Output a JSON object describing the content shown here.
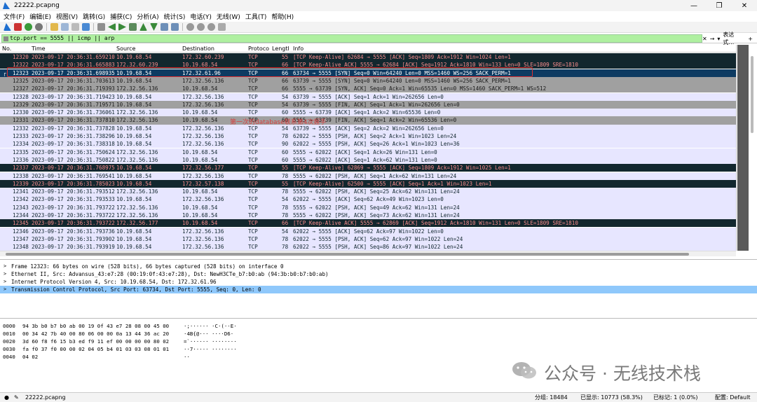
{
  "window": {
    "title": "22222.pcapng",
    "minimize": "—",
    "maximize": "❐",
    "close": "✕"
  },
  "menu": [
    "文件(F)",
    "编辑(E)",
    "视图(V)",
    "跳转(G)",
    "捕获(C)",
    "分析(A)",
    "统计(S)",
    "电话(Y)",
    "无线(W)",
    "工具(T)",
    "帮助(H)"
  ],
  "filter": {
    "value": "tcp.port == 5555 || icmp || arp",
    "expression_label": "表达式…",
    "plus": "+",
    "close": "✕",
    "arrow": "→",
    "dropdown": "▾"
  },
  "columns": [
    "No.",
    "Time",
    "Source",
    "Destination",
    "Protocol",
    "Length",
    "Info"
  ],
  "packets": [
    {
      "no": "12320",
      "time": "2023-09-17 20:36:31.659210",
      "src": "10.19.68.54",
      "dst": "172.32.60.239",
      "proto": "TCP",
      "len": "55",
      "info": "[TCP Keep-Alive] 62684 → 5555 [ACK] Seq=1809 Ack=1912 Win=1024 Len=1",
      "style": "dark"
    },
    {
      "no": "12322",
      "time": "2023-09-17 20:36:31.665883",
      "src": "172.32.60.239",
      "dst": "10.19.68.54",
      "proto": "TCP",
      "len": "66",
      "info": "[TCP Keep-Alive ACK] 5555 → 62684 [ACK] Seq=1912 Ack=1810 Win=133 Len=0 SLE=1809 SRE=1810",
      "style": "dark"
    },
    {
      "no": "12323",
      "time": "2023-09-17 20:36:31.698935",
      "src": "10.19.68.54",
      "dst": "172.32.61.96",
      "proto": "TCP",
      "len": "66",
      "info": "63734 → 5555 [SYN] Seq=0 Win=64240 Len=0 MSS=1460 WS=256 SACK_PERM=1",
      "style": "sel"
    },
    {
      "no": "12325",
      "time": "2023-09-17 20:36:31.703613",
      "src": "10.19.68.54",
      "dst": "172.32.56.136",
      "proto": "TCP",
      "len": "66",
      "info": "63739 → 5555 [SYN] Seq=0 Win=64240 Len=0 MSS=1460 WS=256 SACK_PERM=1",
      "style": "gray"
    },
    {
      "no": "12327",
      "time": "2023-09-17 20:36:31.719393",
      "src": "172.32.56.136",
      "dst": "10.19.68.54",
      "proto": "TCP",
      "len": "66",
      "info": "5555 → 63739 [SYN, ACK] Seq=0 Ack=1 Win=65535 Len=0 MSS=1460 SACK_PERM=1 WS=512",
      "style": "gray"
    },
    {
      "no": "12328",
      "time": "2023-09-17 20:36:31.719423",
      "src": "10.19.68.54",
      "dst": "172.32.56.136",
      "proto": "TCP",
      "len": "54",
      "info": "63739 → 5555 [ACK] Seq=1 Ack=1 Win=262656 Len=0",
      "style": "lav"
    },
    {
      "no": "12329",
      "time": "2023-09-17 20:36:31.719571",
      "src": "10.19.68.54",
      "dst": "172.32.56.136",
      "proto": "TCP",
      "len": "54",
      "info": "63739 → 5555 [FIN, ACK] Seq=1 Ack=1 Win=262656 Len=0",
      "style": "gray"
    },
    {
      "no": "12330",
      "time": "2023-09-17 20:36:31.736061",
      "src": "172.32.56.136",
      "dst": "10.19.68.54",
      "proto": "TCP",
      "len": "60",
      "info": "5555 → 63739 [ACK] Seq=1 Ack=2 Win=65536 Len=0",
      "style": "lav"
    },
    {
      "no": "12331",
      "time": "2023-09-17 20:36:31.737810",
      "src": "172.32.56.136",
      "dst": "10.19.68.54",
      "proto": "TCP",
      "len": "60",
      "info": "5555 → 63739 [FIN, ACK] Seq=1 Ack=2 Win=65536 Len=0",
      "style": "gray"
    },
    {
      "no": "12332",
      "time": "2023-09-17 20:36:31.737828",
      "src": "10.19.68.54",
      "dst": "172.32.56.136",
      "proto": "TCP",
      "len": "54",
      "info": "63739 → 5555 [ACK] Seq=2 Ack=2 Win=262656 Len=0",
      "style": "lav"
    },
    {
      "no": "12333",
      "time": "2023-09-17 20:36:31.738296",
      "src": "10.19.68.54",
      "dst": "172.32.56.136",
      "proto": "TCP",
      "len": "78",
      "info": "62022 → 5555 [PSH, ACK] Seq=2 Ack=1 Win=1023 Len=24",
      "style": "lav"
    },
    {
      "no": "12334",
      "time": "2023-09-17 20:36:31.738318",
      "src": "10.19.68.54",
      "dst": "172.32.56.136",
      "proto": "TCP",
      "len": "90",
      "info": "62022 → 5555 [PSH, ACK] Seq=26 Ack=1 Win=1023 Len=36",
      "style": "lav"
    },
    {
      "no": "12335",
      "time": "2023-09-17 20:36:31.750624",
      "src": "172.32.56.136",
      "dst": "10.19.68.54",
      "proto": "TCP",
      "len": "60",
      "info": "5555 → 62022 [ACK] Seq=1 Ack=26 Win=131 Len=0",
      "style": "lav"
    },
    {
      "no": "12336",
      "time": "2023-09-17 20:36:31.750822",
      "src": "172.32.56.136",
      "dst": "10.19.68.54",
      "proto": "TCP",
      "len": "60",
      "info": "5555 → 62022 [ACK] Seq=1 Ack=62 Win=131 Len=0",
      "style": "lav"
    },
    {
      "no": "12337",
      "time": "2023-09-17 20:36:31.768975",
      "src": "10.19.68.54",
      "dst": "172.32.56.177",
      "proto": "TCP",
      "len": "55",
      "info": "[TCP Keep-Alive] 62869 → 5555 [ACK] Seq=1809 Ack=1912 Win=1025 Len=1",
      "style": "dark"
    },
    {
      "no": "12338",
      "time": "2023-09-17 20:36:31.769541",
      "src": "10.19.68.54",
      "dst": "172.32.56.136",
      "proto": "TCP",
      "len": "78",
      "info": "5555 → 62022 [PSH, ACK] Seq=1 Ack=62 Win=131 Len=24",
      "style": "lav"
    },
    {
      "no": "12339",
      "time": "2023-09-17 20:36:31.785023",
      "src": "10.19.68.54",
      "dst": "172.32.57.138",
      "proto": "TCP",
      "len": "55",
      "info": "[TCP Keep-Alive] 62500 → 5555 [ACK] Seq=1 Ack=1 Win=1023 Len=1",
      "style": "dark"
    },
    {
      "no": "12341",
      "time": "2023-09-17 20:36:31.793512",
      "src": "172.32.56.136",
      "dst": "10.19.68.54",
      "proto": "TCP",
      "len": "78",
      "info": "5555 → 62022 [PSH, ACK] Seq=25 Ack=62 Win=131 Len=24",
      "style": "lav"
    },
    {
      "no": "12342",
      "time": "2023-09-17 20:36:31.793533",
      "src": "10.19.68.54",
      "dst": "172.32.56.136",
      "proto": "TCP",
      "len": "54",
      "info": "62022 → 5555 [ACK] Seq=62 Ack=49 Win=1023 Len=0",
      "style": "lav"
    },
    {
      "no": "12343",
      "time": "2023-09-17 20:36:31.793722",
      "src": "172.32.56.136",
      "dst": "10.19.68.54",
      "proto": "TCP",
      "len": "78",
      "info": "5555 → 62022 [PSH, ACK] Seq=49 Ack=62 Win=131 Len=24",
      "style": "lav"
    },
    {
      "no": "12344",
      "time": "2023-09-17 20:36:31.793722",
      "src": "172.32.56.136",
      "dst": "10.19.68.54",
      "proto": "TCP",
      "len": "78",
      "info": "5555 → 62022 [PSH, ACK] Seq=73 Ack=62 Win=131 Len=24",
      "style": "lav"
    },
    {
      "no": "12345",
      "time": "2023-09-17 20:36:31.793722",
      "src": "172.32.56.177",
      "dst": "10.19.68.54",
      "proto": "TCP",
      "len": "66",
      "info": "[TCP Keep-Alive ACK] 5555 → 62869 [ACK] Seq=1912 Ack=1810 Win=131 Len=0 SLE=1809 SRE=1810",
      "style": "dark"
    },
    {
      "no": "12346",
      "time": "2023-09-17 20:36:31.793736",
      "src": "10.19.68.54",
      "dst": "172.32.56.136",
      "proto": "TCP",
      "len": "54",
      "info": "62022 → 5555 [ACK] Seq=62 Ack=97 Win=1022 Len=0",
      "style": "lav"
    },
    {
      "no": "12347",
      "time": "2023-09-17 20:36:31.793902",
      "src": "10.19.68.54",
      "dst": "172.32.56.136",
      "proto": "TCP",
      "len": "78",
      "info": "62022 → 5555 [PSH, ACK] Seq=62 Ack=97 Win=1022 Len=24",
      "style": "lav"
    },
    {
      "no": "12348",
      "time": "2023-09-17 20:36:31.793919",
      "src": "10.19.68.54",
      "dst": "172.32.56.136",
      "proto": "TCP",
      "len": "78",
      "info": "62022 → 5555 [PSH, ACK] Seq=86 Ack=97 Win=1022 Len=24",
      "style": "lav"
    }
  ],
  "watermark_overlay": "第一次的database联系第4次握手",
  "details": [
    {
      "text": "Frame 12323: 66 bytes on wire (528 bits), 66 bytes captured (528 bits) on interface 0",
      "selected": false
    },
    {
      "text": "Ethernet II, Src: Advansus_43:e7:28 (00:19:0f:43:e7:28), Dst: NewH3CTe_b7:b0:ab (94:3b:b0:b7:b0:ab)",
      "selected": false
    },
    {
      "text": "Internet Protocol Version 4, Src: 10.19.68.54, Dst: 172.32.61.96",
      "selected": false
    },
    {
      "text": "Transmission Control Protocol, Src Port: 63734, Dst Port: 5555, Seq: 0, Len: 0",
      "selected": true
    }
  ],
  "hex": [
    {
      "off": "0000",
      "bytes": "94 3b b0 b7 b0 ab 00 19  0f 43 e7 28 08 00 45 00",
      "ascii": "·;······ ·C·(··E·"
    },
    {
      "off": "0010",
      "bytes": "00 34 42 7b 40 00 80 06  00 00 0a 13 44 36 ac 20",
      "ascii": "·4B{@··· ····D6· "
    },
    {
      "off": "0020",
      "bytes": "3d 60 f8 f6 15 b3 ed f9  11 ef 00 00 00 00 80 02",
      "ascii": "=`······ ········"
    },
    {
      "off": "0030",
      "bytes": "fa f0 37 f0 00 00 02 04  05 b4 01 03 03 08 01 01",
      "ascii": "··7····· ········"
    },
    {
      "off": "0040",
      "bytes": "04 02",
      "ascii": "··"
    }
  ],
  "brand_watermark": "公众号 · 无线技术栈",
  "status": {
    "file": "22222.pcapng",
    "packets": "分组: 18484",
    "displayed": "已显示: 10773 (58.3%)",
    "marked": "已标记: 1 (0.0%)",
    "profile": "配置: Default"
  },
  "colors": {
    "dark": "#12272e",
    "selected": "#0e3b62",
    "gray": "#a0a0a0",
    "lavender": "#e7e6ff",
    "filter_ok": "#aff0a0",
    "highlight_box": "#e03030"
  }
}
